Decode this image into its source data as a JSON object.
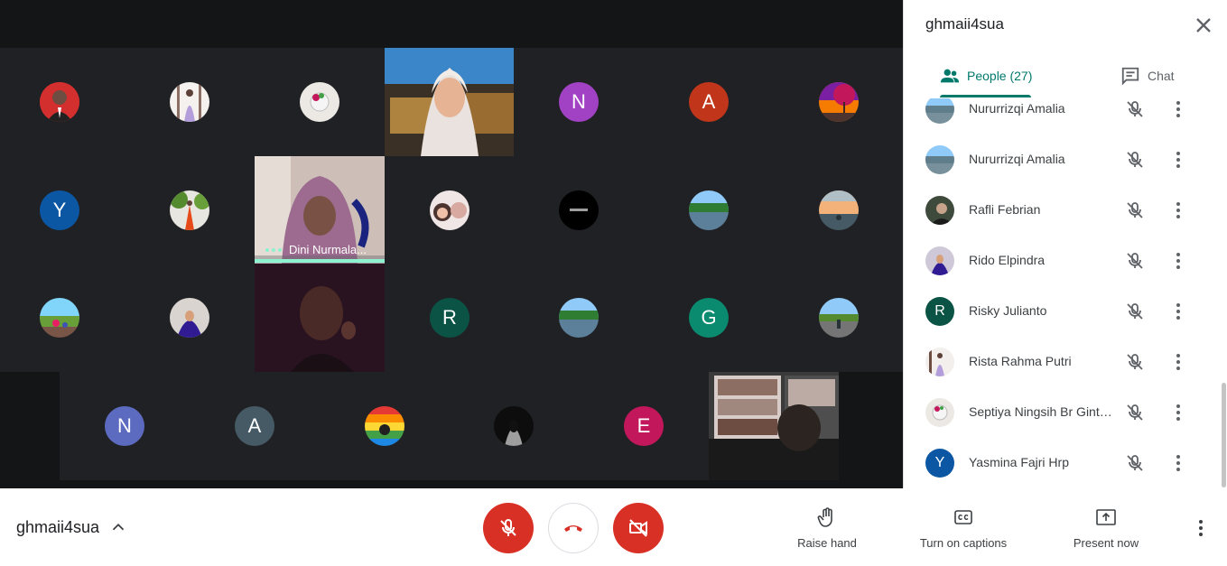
{
  "meeting": {
    "code": "ghmaii4sua"
  },
  "panel": {
    "title": "ghmaii4sua",
    "people_tab": "People (27)",
    "chat_tab": "Chat"
  },
  "participants": [
    {
      "name": "Nururrizqi Amalia",
      "avatar": "landscape-photo"
    },
    {
      "name": "Nururrizqi Amalia",
      "avatar": "landscape-photo"
    },
    {
      "name": "Rafli Febrian",
      "avatar": "photo"
    },
    {
      "name": "Rido Elpindra",
      "avatar": "photo"
    },
    {
      "name": "Risky Julianto",
      "avatar": "letter",
      "letter": "R",
      "color": "#0b5345"
    },
    {
      "name": "Rista Rahma Putri",
      "avatar": "photo"
    },
    {
      "name": "Septiya Ningsih Br Ginting",
      "avatar": "photo"
    },
    {
      "name": "Yasmina Fajri Hrp",
      "avatar": "letter",
      "letter": "Y",
      "color": "#0b57a4"
    }
  ],
  "grid": {
    "video_label": "Dini Nurmala...",
    "letters": {
      "r1_n": "N",
      "r1_a": "A",
      "r2_y": "Y",
      "r3_r": "R",
      "r3_g": "G",
      "r4_n": "N",
      "r4_a": "A",
      "r4_e": "E"
    },
    "colors": {
      "n_purple": "#a142c4",
      "a_red": "#c1361a",
      "y_blue": "#0b57a4",
      "r_green": "#0b5345",
      "g_teal": "#0a8a6e",
      "n_indigo": "#5c6bc0",
      "a_slate": "#455a64",
      "e_pink": "#c2185b"
    }
  },
  "controls": {
    "raise_hand": "Raise hand",
    "captions": "Turn on captions",
    "present": "Present now"
  }
}
